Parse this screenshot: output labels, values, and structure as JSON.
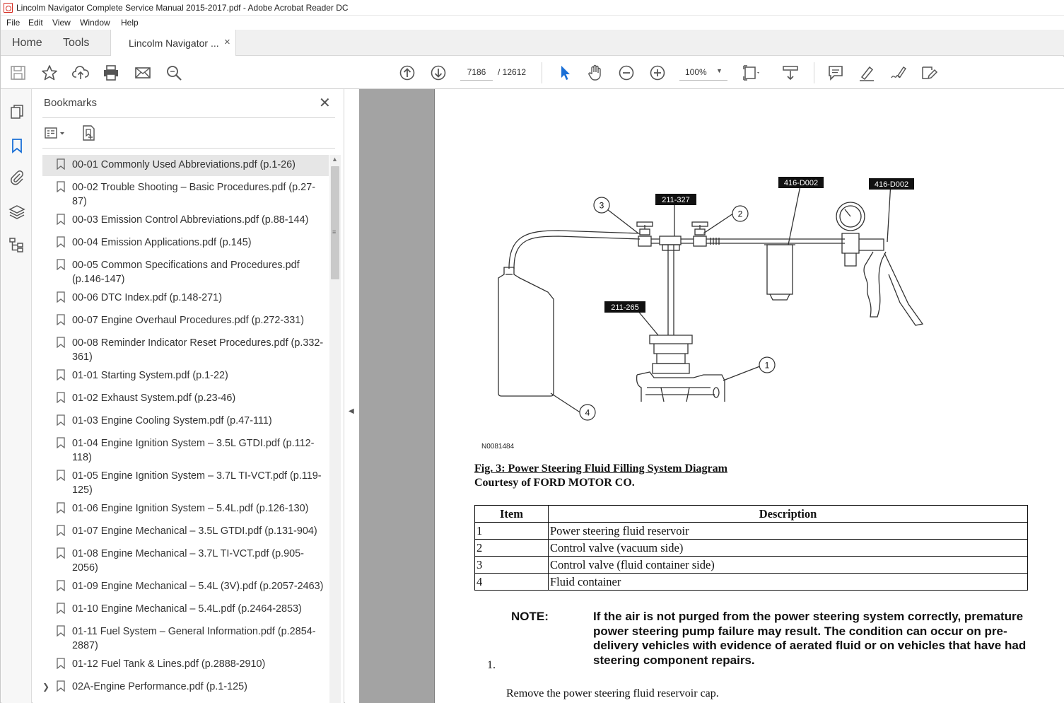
{
  "window": {
    "title": "Lincolm Navigator Complete Service Manual 2015-2017.pdf - Adobe Acrobat Reader DC"
  },
  "menu": [
    "File",
    "Edit",
    "View",
    "Window",
    "Help"
  ],
  "tabs": {
    "home": "Home",
    "tools": "Tools",
    "document": "Lincolm Navigator ...",
    "close": "×"
  },
  "toolbar": {
    "page_current": "7186",
    "page_total": "/  12612",
    "zoom": "100%"
  },
  "bookmarks": {
    "title": "Bookmarks",
    "close": "✕",
    "items": [
      "00-01 Commonly Used Abbreviations.pdf (p.1-26)",
      "00-02 Trouble Shooting – Basic Procedures.pdf (p.27-87)",
      "00-03 Emission Control Abbreviations.pdf (p.88-144)",
      "00-04 Emission Applications.pdf (p.145)",
      "00-05 Common Specifications and Procedures.pdf (p.146-147)",
      "00-06 DTC Index.pdf (p.148-271)",
      "00-07 Engine Overhaul Procedures.pdf (p.272-331)",
      "00-08 Reminder Indicator Reset Procedures.pdf (p.332-361)",
      "01-01 Starting System.pdf (p.1-22)",
      "01-02 Exhaust System.pdf (p.23-46)",
      "01-03 Engine Cooling System.pdf (p.47-111)",
      "01-04 Engine Ignition System – 3.5L GTDI.pdf (p.112-118)",
      "01-05 Engine Ignition System – 3.7L TI-VCT.pdf (p.119-125)",
      "01-06 Engine Ignition System – 5.4L.pdf (p.126-130)",
      "01-07 Engine Mechanical – 3.5L GTDI.pdf (p.131-904)",
      "01-08 Engine Mechanical – 3.7L TI-VCT.pdf (p.905-2056)",
      "01-09 Engine Mechanical – 5.4L (3V).pdf (p.2057-2463)",
      "01-10 Engine Mechanical – 5.4L.pdf (p.2464-2853)",
      "01-11 Fuel System – General Information.pdf (p.2854-2887)",
      "01-12 Fuel Tank & Lines.pdf (p.2888-2910)",
      "02A-Engine Performance.pdf (p.1-125)"
    ]
  },
  "document": {
    "figure": {
      "code": "N0081484",
      "tool_labels": [
        "416-D002",
        "416-D002",
        "211-327",
        "211-265"
      ],
      "callouts": [
        "1",
        "2",
        "3",
        "4"
      ],
      "title": "Fig. 3: Power Steering Fluid Filling System Diagram",
      "credit": "Courtesy of FORD MOTOR CO."
    },
    "table": {
      "headers": [
        "Item",
        "Description"
      ],
      "rows": [
        [
          "1",
          "Power steering fluid reservoir"
        ],
        [
          "2",
          "Control valve (vacuum side)"
        ],
        [
          "3",
          "Control valve (fluid container side)"
        ],
        [
          "4",
          "Fluid container"
        ]
      ]
    },
    "note_label": "NOTE:",
    "note_text": "If the air is not purged from the power steering system correctly, premature power steering pump failure may result. The condition can occur on pre-delivery vehicles with evidence of aerated fluid or on vehicles that have had steering component repairs.",
    "step_number": "1.",
    "step_text": "Remove the power steering fluid reservoir cap."
  }
}
